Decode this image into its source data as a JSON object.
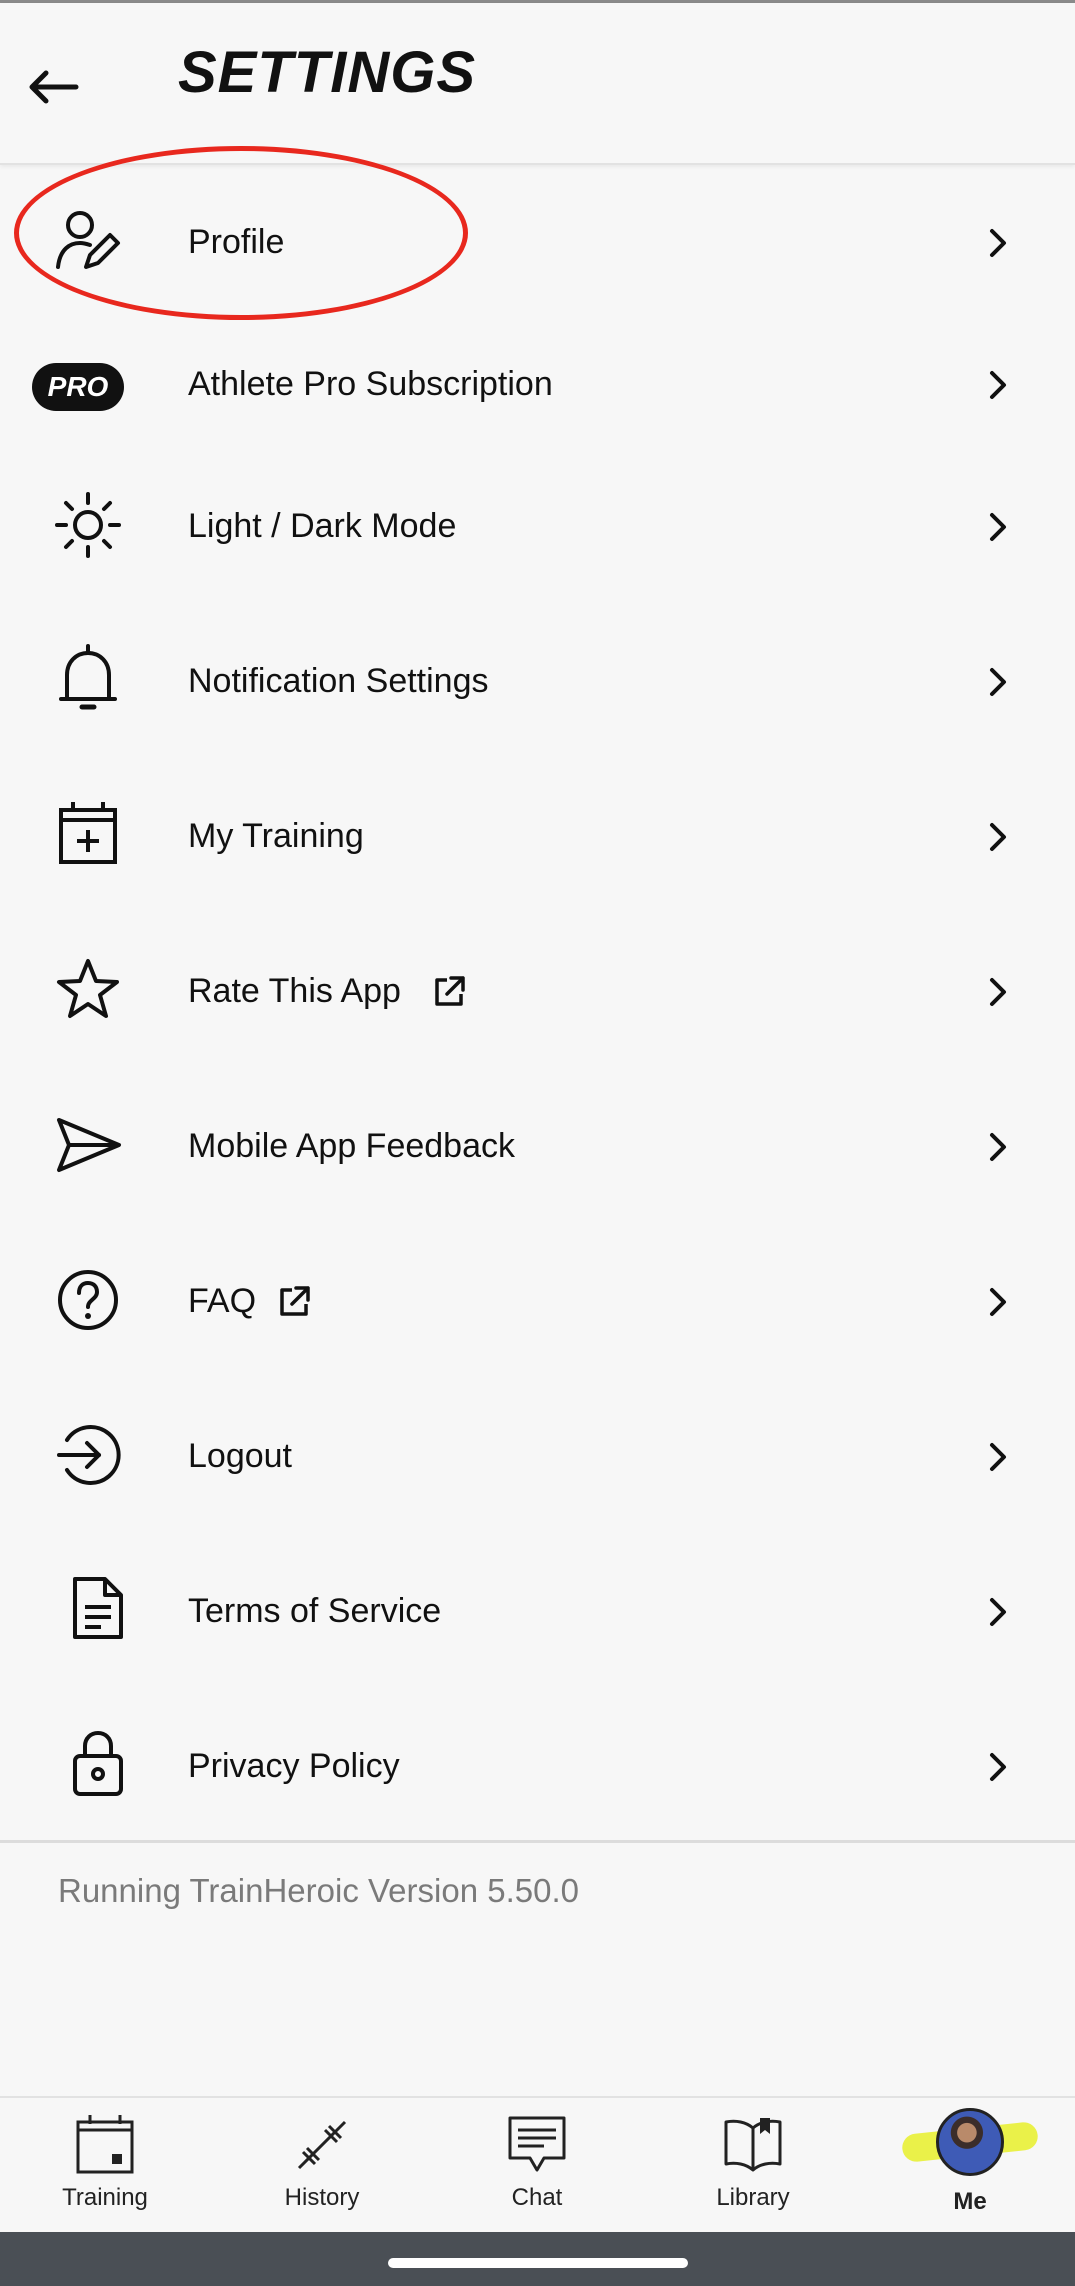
{
  "header": {
    "title": "SETTINGS"
  },
  "menu": [
    {
      "label": "Profile",
      "icon": "profile-edit-icon"
    },
    {
      "label": "Athlete Pro Subscription",
      "icon": "pro-badge",
      "badge": "PRO"
    },
    {
      "label": "Light / Dark Mode",
      "icon": "sun-icon"
    },
    {
      "label": "Notification Settings",
      "icon": "bell-icon"
    },
    {
      "label": "My Training",
      "icon": "calendar-plus-icon"
    },
    {
      "label": "Rate This App",
      "icon": "star-icon",
      "external": true
    },
    {
      "label": "Mobile App Feedback",
      "icon": "send-icon"
    },
    {
      "label": "FAQ",
      "icon": "question-circle-icon",
      "external": true
    },
    {
      "label": "Logout",
      "icon": "logout-icon"
    },
    {
      "label": "Terms of Service",
      "icon": "document-icon"
    },
    {
      "label": "Privacy Policy",
      "icon": "lock-icon"
    }
  ],
  "footer": {
    "version": "Running TrainHeroic Version 5.50.0"
  },
  "bottom_nav": [
    {
      "label": "Training",
      "icon": "calendar-icon"
    },
    {
      "label": "History",
      "icon": "barbell-icon"
    },
    {
      "label": "Chat",
      "icon": "chat-icon"
    },
    {
      "label": "Library",
      "icon": "book-icon"
    },
    {
      "label": "Me",
      "icon": "avatar",
      "active": true
    }
  ],
  "colors": {
    "annotation": "#e8281e",
    "highlight": "#e8f02a",
    "text": "#111111",
    "muted": "#7a7a7a"
  }
}
